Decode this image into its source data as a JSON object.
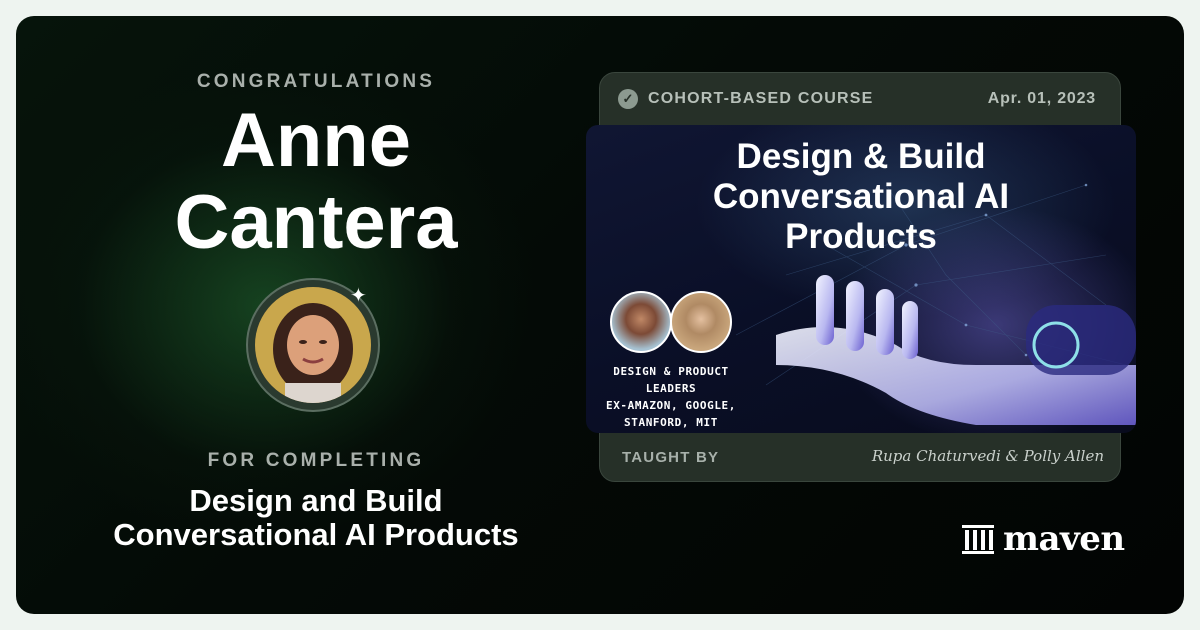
{
  "certificate": {
    "congratulations_label": "CONGRATULATIONS",
    "recipient_first": "Anne",
    "recipient_last": "Cantera",
    "for_completing_label": "FOR COMPLETING",
    "course_title_line1": "Design and Build",
    "course_title_line2": "Conversational AI Products"
  },
  "course_card": {
    "type_label": "COHORT-BASED COURSE",
    "date": "Apr. 01, 2023",
    "banner_title_line1": "Design & Build",
    "banner_title_line2": "Conversational AI",
    "banner_title_line3": "Products",
    "instructor_tagline_line1": "DESIGN & PRODUCT",
    "instructor_tagline_line2": "LEADERS",
    "instructor_tagline_line3": "EX-AMAZON, GOOGLE,",
    "instructor_tagline_line4": "STANFORD, MIT",
    "taught_by_label": "TAUGHT BY",
    "instructors_signature": "Rupa Chaturvedi & Polly Allen"
  },
  "brand": {
    "logo_text": "maven",
    "logo_icon": "columns-icon"
  },
  "colors": {
    "background": "#040a06",
    "accent_glow": "#246e34",
    "card": "#263028"
  }
}
